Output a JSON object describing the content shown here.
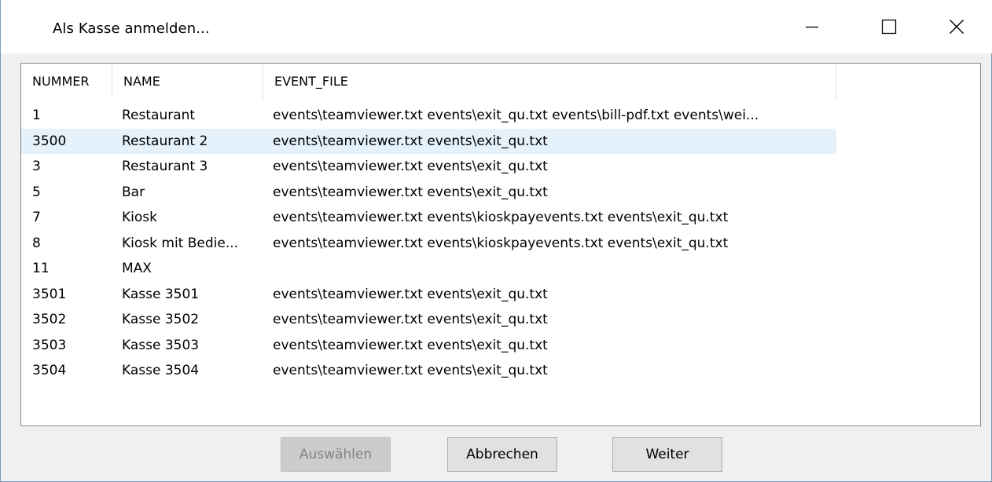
{
  "window": {
    "title": "Als Kasse anmelden...",
    "controls": {
      "minimize": "minimize-icon",
      "maximize": "maximize-icon",
      "close": "close-icon"
    }
  },
  "list": {
    "columns": [
      "NUMMER",
      "NAME",
      "EVENT_FILE"
    ],
    "selected_index": 1,
    "rows": [
      [
        "1",
        "Restaurant",
        "events\\teamviewer.txt events\\exit_qu.txt events\\bill-pdf.txt events\\wei..."
      ],
      [
        "3500",
        "Restaurant 2",
        "events\\teamviewer.txt events\\exit_qu.txt"
      ],
      [
        "3",
        "Restaurant 3",
        "events\\teamviewer.txt events\\exit_qu.txt"
      ],
      [
        "5",
        "Bar",
        "events\\teamviewer.txt events\\exit_qu.txt"
      ],
      [
        "7",
        "Kiosk",
        "events\\teamviewer.txt events\\kioskpayevents.txt events\\exit_qu.txt"
      ],
      [
        "8",
        "Kiosk mit Bedie...",
        "events\\teamviewer.txt events\\kioskpayevents.txt events\\exit_qu.txt"
      ],
      [
        "11",
        "MAX",
        ""
      ],
      [
        "3501",
        "Kasse 3501",
        "events\\teamviewer.txt events\\exit_qu.txt"
      ],
      [
        "3502",
        "Kasse 3502",
        "events\\teamviewer.txt events\\exit_qu.txt"
      ],
      [
        "3503",
        "Kasse 3503",
        "events\\teamviewer.txt events\\exit_qu.txt"
      ],
      [
        "3504",
        "Kasse 3504",
        "events\\teamviewer.txt events\\exit_qu.txt"
      ]
    ]
  },
  "buttons": {
    "select": "Auswählen",
    "cancel": "Abbrechen",
    "next": "Weiter"
  },
  "colors": {
    "selection": "#e5f1fb",
    "dialog_bg": "#f0f0f0",
    "window_border": "#7a9cc2"
  }
}
